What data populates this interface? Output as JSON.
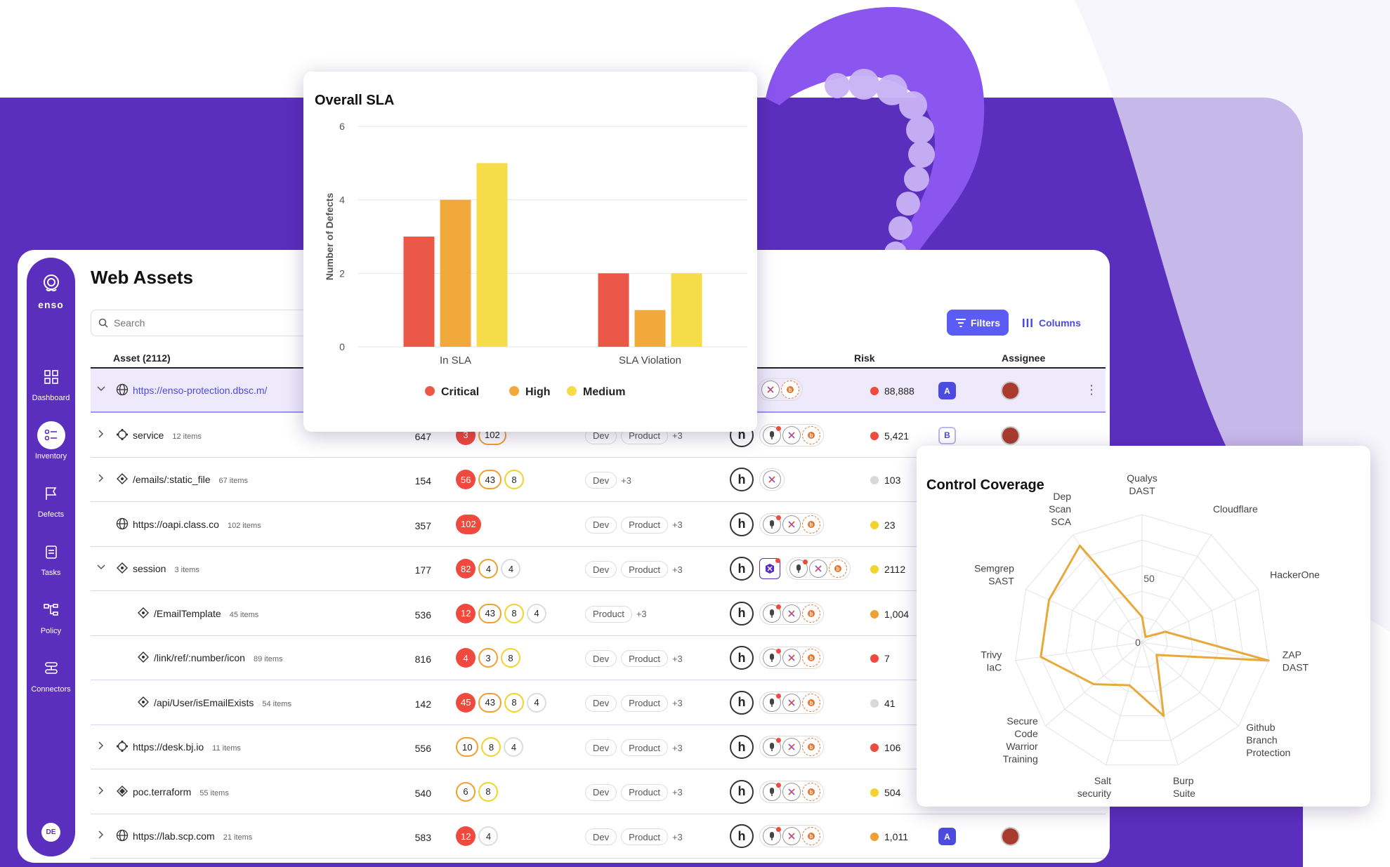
{
  "app": {
    "logo_text": "enso",
    "page_title": "Web Assets",
    "user_initials": "DE",
    "nav": [
      {
        "label": "Dashboard",
        "icon": "grid-icon"
      },
      {
        "label": "Inventory",
        "icon": "list-icon"
      },
      {
        "label": "Defects",
        "icon": "flag-icon"
      },
      {
        "label": "Tasks",
        "icon": "clipboard-icon"
      },
      {
        "label": "Policy",
        "icon": "tree-icon"
      },
      {
        "label": "Connectors",
        "icon": "connectors-icon"
      }
    ],
    "active_nav": "Inventory"
  },
  "toolbar": {
    "search_placeholder": "Search",
    "filters_label": "Filters",
    "columns_label": "Columns"
  },
  "table": {
    "headers": {
      "asset": "Asset (2112)",
      "risk": "Risk",
      "assignee": "Assignee"
    },
    "rows": [
      {
        "name": "https://enso-protection.dbsc.m/",
        "items": "",
        "count": "",
        "critical": "",
        "high": "",
        "medium": "",
        "low": "",
        "tags": [],
        "more": "",
        "risk": "88,888",
        "risk_color": "#f0493d",
        "grade": "A",
        "selected": true,
        "expand": "down",
        "indent": 0,
        "icon": "globe-icon",
        "link": true,
        "tools": true
      },
      {
        "name": "service",
        "items": "12 items",
        "count": "647",
        "critical": "3",
        "high": "102",
        "medium": "",
        "low": "",
        "tags": [
          "Dev",
          "Product"
        ],
        "more": "+3",
        "risk": "5,421",
        "risk_color": "#f0493d",
        "grade": "B",
        "selected": false,
        "expand": "right",
        "indent": 0,
        "icon": "service-icon",
        "link": false,
        "tools": true
      },
      {
        "name": "/emails/:static_file",
        "items": "67 items",
        "count": "154",
        "critical": "56",
        "high": "43",
        "medium": "8",
        "low": "",
        "tags": [
          "Dev"
        ],
        "more": "+3",
        "risk": "103",
        "risk_color": "#d8d8d8",
        "grade": "",
        "selected": false,
        "expand": "right",
        "indent": 0,
        "icon": "endpoint-icon",
        "link": false,
        "tools": "short"
      },
      {
        "name": "https://oapi.class.co",
        "items": "102 items",
        "count": "357",
        "critical": "102",
        "high": "",
        "medium": "",
        "low": "",
        "tags": [
          "Dev",
          "Product"
        ],
        "more": "+3",
        "risk": "23",
        "risk_color": "#f4d22c",
        "grade": "",
        "selected": false,
        "expand": "none",
        "indent": 0,
        "icon": "globe-icon",
        "link": false,
        "tools": true
      },
      {
        "name": "session",
        "items": "3 items",
        "count": "177",
        "critical": "82",
        "high": "4",
        "medium": "",
        "low": "4",
        "tags": [
          "Dev",
          "Product"
        ],
        "more": "+3",
        "risk": "2112",
        "risk_color": "#f4d22c",
        "grade": "",
        "selected": false,
        "expand": "down",
        "indent": 0,
        "icon": "endpoint-icon",
        "link": false,
        "tools": "extra"
      },
      {
        "name": "/EmailTemplate",
        "items": "45 items",
        "count": "536",
        "critical": "12",
        "high": "43",
        "medium": "8",
        "low": "4",
        "tags": [
          "Product"
        ],
        "more": "+3",
        "risk": "1,004",
        "risk_color": "#f0a030",
        "grade": "",
        "selected": false,
        "expand": "none",
        "indent": 1,
        "icon": "endpoint-icon",
        "link": false,
        "tools": true
      },
      {
        "name": "/link/ref/:number/icon",
        "items": "89 items",
        "count": "816",
        "critical": "4",
        "high": "3",
        "medium": "8",
        "low": "",
        "tags": [
          "Dev",
          "Product"
        ],
        "more": "+3",
        "risk": "7",
        "risk_color": "#f0493d",
        "grade": "",
        "selected": false,
        "expand": "none",
        "indent": 1,
        "icon": "endpoint-icon",
        "link": false,
        "tools": true
      },
      {
        "name": "/api/User/isEmailExists",
        "items": "54 items",
        "count": "142",
        "critical": "45",
        "high": "43",
        "medium": "8",
        "low": "4",
        "tags": [
          "Dev",
          "Product"
        ],
        "more": "+3",
        "risk": "41",
        "risk_color": "#d8d8d8",
        "grade": "",
        "selected": false,
        "expand": "none",
        "indent": 1,
        "icon": "endpoint-icon",
        "link": false,
        "tools": true
      },
      {
        "name": "https://desk.bj.io",
        "items": "11 items",
        "count": "556",
        "critical": "",
        "high": "10",
        "medium": "8",
        "low": "4",
        "tags": [
          "Dev",
          "Product"
        ],
        "more": "+3",
        "risk": "106",
        "risk_color": "#f0493d",
        "grade": "",
        "selected": false,
        "expand": "right",
        "indent": 0,
        "icon": "service-icon",
        "link": false,
        "tools": true
      },
      {
        "name": "poc.terraform",
        "items": "55 items",
        "count": "540",
        "critical": "",
        "high": "6",
        "medium": "8",
        "low": "",
        "tags": [
          "Dev",
          "Product"
        ],
        "more": "+3",
        "risk": "504",
        "risk_color": "#f4d22c",
        "grade": "",
        "selected": false,
        "expand": "right",
        "indent": 0,
        "icon": "terraform-icon",
        "link": false,
        "tools": true
      },
      {
        "name": "https://lab.scp.com",
        "items": "21 items",
        "count": "583",
        "critical": "12",
        "high": "",
        "medium": "",
        "low": "4",
        "tags": [
          "Dev",
          "Product"
        ],
        "more": "+3",
        "risk": "1,011",
        "risk_color": "#f0a030",
        "grade": "A",
        "selected": false,
        "expand": "right",
        "indent": 0,
        "icon": "globe-icon",
        "link": false,
        "tools": true
      }
    ]
  },
  "colors": {
    "brand": "#5b2fbe",
    "critical": "#f0493d",
    "high": "#f0a030",
    "medium": "#f4d22c",
    "accent": "#5b5cf5"
  },
  "chart_data": [
    {
      "type": "bar",
      "title": "Overall SLA",
      "categories": [
        "In SLA",
        "SLA Violation"
      ],
      "series": [
        {
          "name": "Critical",
          "color": "#eb5848",
          "values": [
            3,
            2
          ]
        },
        {
          "name": "High",
          "color": "#f2a93c",
          "values": [
            4,
            1
          ]
        },
        {
          "name": "Medium",
          "color": "#f6dc48",
          "values": [
            5,
            2
          ]
        }
      ],
      "ylabel": "Number of Defects",
      "xlabel": "",
      "ylim": [
        0,
        6
      ],
      "yticks": [
        0,
        2,
        4,
        6
      ],
      "grid": true,
      "legend": "bottom"
    },
    {
      "type": "radar",
      "title": "Control Coverage",
      "axes": [
        "Qualys DAST",
        "Cloudflare",
        "HackerOne",
        "ZAP DAST",
        "Github Branch Protection",
        "Burp Suite",
        "Salt security",
        "Secure Code Warrior Training",
        "Trivy IaC",
        "Semgrep SAST",
        "Dep Scan SCA"
      ],
      "values": [
        20,
        5,
        20,
        100,
        15,
        60,
        35,
        50,
        80,
        80,
        90
      ],
      "ticks": [
        "0",
        "50"
      ],
      "rmax": 100,
      "color": "#e8a93c"
    }
  ]
}
